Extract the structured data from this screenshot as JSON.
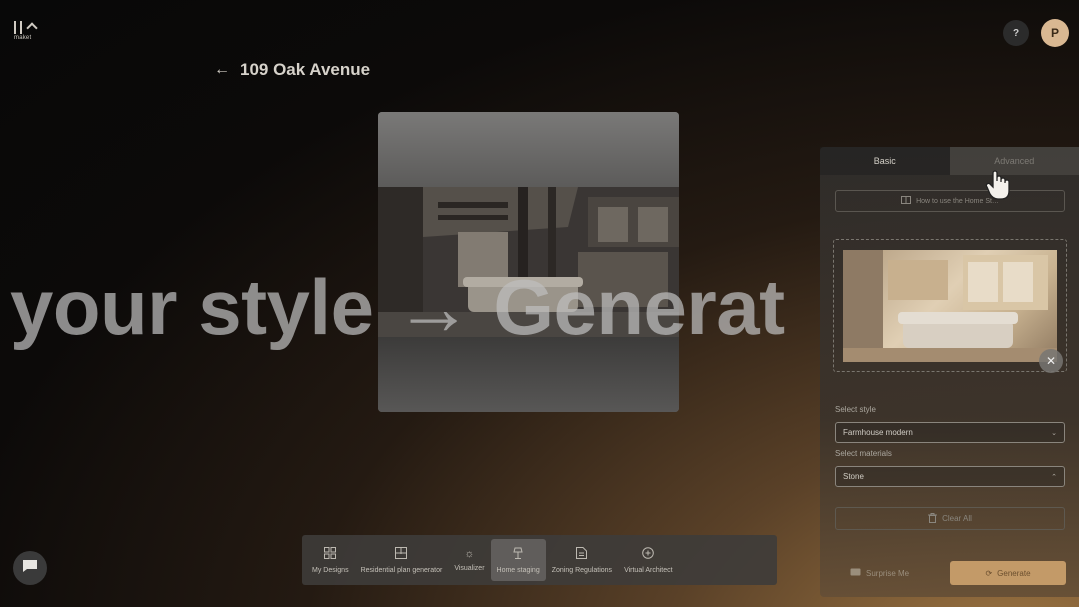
{
  "app": {
    "logo_text": "maket"
  },
  "topbar": {
    "help_label": "?",
    "avatar_initial": "P"
  },
  "project": {
    "title": "109 Oak Avenue"
  },
  "overlay_text": "your style → Generat",
  "panel": {
    "tabs": [
      {
        "label": "Basic",
        "active": true
      },
      {
        "label": "Advanced",
        "active": false
      }
    ],
    "howto_label": "How to use the Home St…",
    "style_label": "Select style",
    "style_value": "Farmhouse modern",
    "materials_label": "Select materials",
    "materials_value": "Stone",
    "clear_label": "Clear All",
    "surprise_label": "Surprise Me",
    "generate_label": "Generate"
  },
  "toolbar": {
    "items": [
      {
        "label": "My Designs",
        "icon": "grid-icon",
        "active": false
      },
      {
        "label": "Residential plan generator",
        "icon": "floorplan-icon",
        "active": false
      },
      {
        "label": "Visualizer",
        "icon": "sun-icon",
        "active": false
      },
      {
        "label": "Home staging",
        "icon": "lamp-icon",
        "active": true
      },
      {
        "label": "Zoning Regulations",
        "icon": "document-icon",
        "active": false
      },
      {
        "label": "Virtual Architect",
        "icon": "chat-plus-icon",
        "active": false
      }
    ]
  },
  "colors": {
    "accent": "#c39a68",
    "panel_bg": "#3a3530",
    "toolbar_bg": "#3e3c3a",
    "background": "#0c0a09"
  }
}
